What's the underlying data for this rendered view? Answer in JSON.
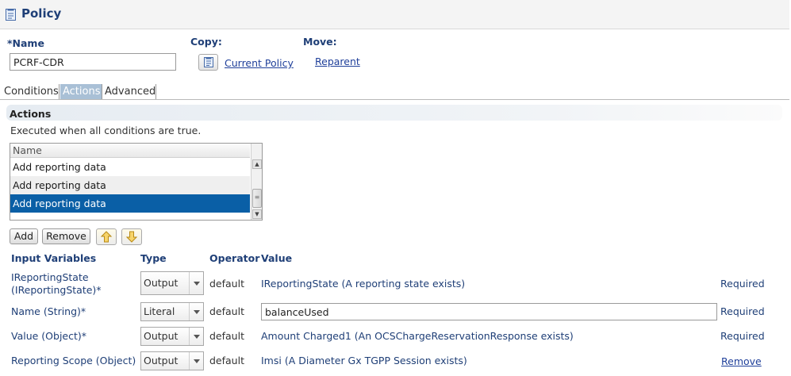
{
  "page": {
    "title": "Policy",
    "name_label": "*Name",
    "name_value": "PCRF-CDR",
    "copy_label": "Copy:",
    "copy_link": "Current Policy",
    "move_label": "Move:",
    "move_link": "Reparent"
  },
  "tabs": [
    {
      "label": "Conditions",
      "active": false
    },
    {
      "label": "Actions",
      "active": true
    },
    {
      "label": "Advanced",
      "active": false
    }
  ],
  "actions": {
    "title": "Actions",
    "subtitle": "Executed when all conditions are true.",
    "list_header": "Name",
    "items": [
      "Add reporting data",
      "Add reporting data",
      "Add reporting data"
    ],
    "selected_index": 2,
    "add_label": "Add",
    "remove_label": "Remove"
  },
  "variables": {
    "headers": {
      "input": "Input Variables",
      "type": "Type",
      "operator": "Operator",
      "value": "Value"
    },
    "rows": [
      {
        "name_line1": "IReportingState",
        "name_line2": "(IReportingState)*",
        "type": "Output",
        "operator": "default",
        "value": "IReportingState (A reporting state exists)",
        "status": "Required"
      },
      {
        "name_line1": "Name (String)*",
        "type": "Literal",
        "operator": "default",
        "value": "balanceUsed",
        "status": "Required"
      },
      {
        "name_line1": "Value (Object)*",
        "type": "Output",
        "operator": "default",
        "value": "Amount Charged1 (An OCSChargeReservationResponse exists)",
        "status": "Required"
      },
      {
        "name_line1": "Reporting Scope (Object)",
        "type": "Output",
        "operator": "default",
        "value": "Imsi (A Diameter Gx TGPP Session exists)",
        "status": "Remove"
      }
    ]
  },
  "icons": {
    "title_icon": "document-icon",
    "copy_icon": "copy-document-icon",
    "up": "arrow-up-icon",
    "down": "arrow-down-icon"
  }
}
